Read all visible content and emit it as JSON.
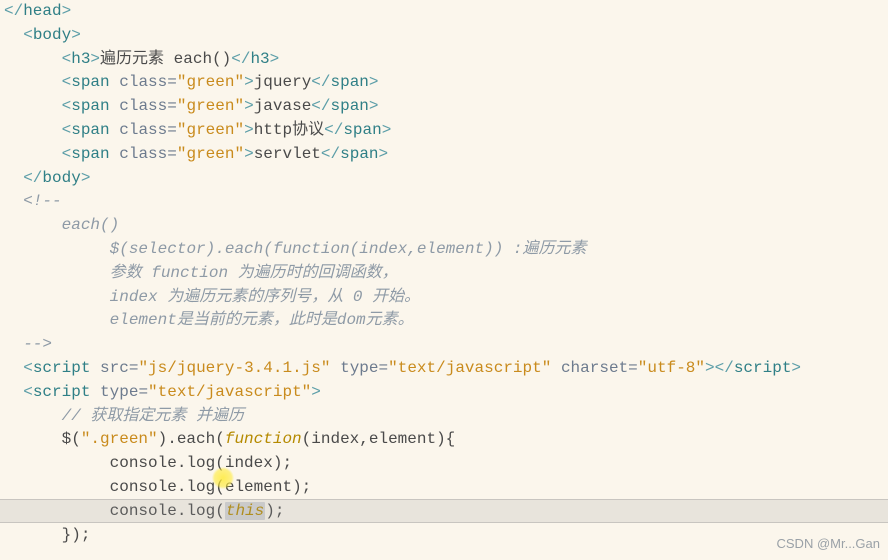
{
  "lines": {
    "l0": {
      "indent": "",
      "close_head": "</head>"
    },
    "l1": {
      "indent": "  ",
      "body_open": "<body>"
    },
    "l2": {
      "indent": "      ",
      "h3_text": "遍历元素 each()"
    },
    "l3": {
      "indent": "      ",
      "cls": "\"green\"",
      "span_txt": "jquery"
    },
    "l4": {
      "indent": "      ",
      "cls": "\"green\"",
      "span_txt": "javase"
    },
    "l5": {
      "indent": "      ",
      "cls": "\"green\"",
      "span_txt": "http协议"
    },
    "l6": {
      "indent": "      ",
      "cls": "\"green\"",
      "span_txt": "servlet"
    },
    "l7": {
      "indent": "  ",
      "body_close": "</body>"
    },
    "l8": {
      "indent": "  ",
      "cmt_open": "<!--"
    },
    "l9": {
      "indent": "      ",
      "c": "each()"
    },
    "l10": {
      "indent": "           ",
      "c": "$(selector).each(function(index,element)) :遍历元素"
    },
    "l11": {
      "indent": "           ",
      "c": "参数 function 为遍历时的回调函数，"
    },
    "l12": {
      "indent": "           ",
      "c": "index 为遍历元素的序列号，从 0 开始。"
    },
    "l13": {
      "indent": "           ",
      "c": "element是当前的元素，此时是dom元素。"
    },
    "l14": {
      "indent": "  ",
      "cmt_close": "-->"
    },
    "l15": {
      "indent": "  ",
      "src": "\"js/jquery-3.4.1.js\"",
      "type": "\"text/javascript\"",
      "charset": "\"utf-8\""
    },
    "l16": {
      "indent": "  ",
      "type": "\"text/javascript\""
    },
    "l17": {
      "indent": "      ",
      "c": "// 获取指定元素 并遍历"
    },
    "l18": {
      "indent": "      ",
      "sel": "\".green\"",
      "func": "function",
      "args": "(index,element){"
    },
    "l19": {
      "indent": "           ",
      "c": "console.log(index);"
    },
    "l20": {
      "indent": "           ",
      "head": "console.log(",
      "arg": "element",
      "tail": ");"
    },
    "l21": {
      "indent": "           ",
      "head": "console.log(",
      "this": "this",
      "tail": ");"
    },
    "l22": {
      "indent": "      ",
      "c": "});"
    }
  },
  "watermark": "CSDN @Mr...Gan"
}
